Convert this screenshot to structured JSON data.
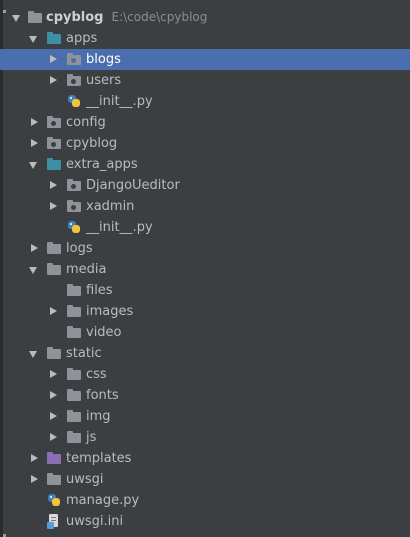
{
  "project": {
    "name": "cpyblog",
    "path": "E:\\code\\cpyblog"
  },
  "tree": {
    "apps": {
      "label": "apps"
    },
    "blogs": {
      "label": "blogs"
    },
    "users": {
      "label": "users"
    },
    "apps_init": {
      "label": "__init__.py"
    },
    "config": {
      "label": "config"
    },
    "cpyblog": {
      "label": "cpyblog"
    },
    "extra_apps": {
      "label": "extra_apps"
    },
    "djangoueditor": {
      "label": "DjangoUeditor"
    },
    "xadmin": {
      "label": "xadmin"
    },
    "extra_init": {
      "label": "__init__.py"
    },
    "logs": {
      "label": "logs"
    },
    "media": {
      "label": "media"
    },
    "files": {
      "label": "files"
    },
    "images": {
      "label": "images"
    },
    "video": {
      "label": "video"
    },
    "static": {
      "label": "static"
    },
    "css": {
      "label": "css"
    },
    "fonts": {
      "label": "fonts"
    },
    "img": {
      "label": "img"
    },
    "js": {
      "label": "js"
    },
    "templates": {
      "label": "templates"
    },
    "uwsgi": {
      "label": "uwsgi"
    },
    "manage": {
      "label": "manage.py"
    },
    "uwsgi_ini": {
      "label": "uwsgi.ini"
    }
  },
  "colors": {
    "background": "#3c3f41",
    "selection": "#4b6eaf",
    "text": "#bbbbbb",
    "folder": "#8f9399",
    "source_folder": "#3d8fa6",
    "templates_folder": "#8a6fb5"
  },
  "selected_item": "blogs"
}
